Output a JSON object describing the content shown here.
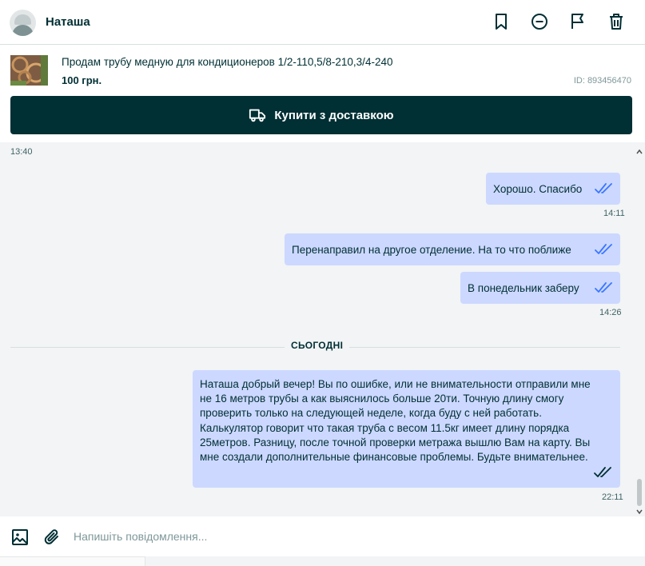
{
  "header": {
    "user_name": "Наташа",
    "icons": [
      "bookmark-icon",
      "block-icon",
      "flag-icon",
      "trash-icon"
    ]
  },
  "ad": {
    "title": "Продам трубу медную для кондиционеров 1/2-110,5/8-210,3/4-240",
    "price": "100 грн.",
    "id_label": "ID: 893456470"
  },
  "buy_button": {
    "label": "Купити з доставкою",
    "icon": "truck-icon"
  },
  "chat": {
    "top_timestamp": "13:40",
    "messages": [
      {
        "text": "Хорошо. Спасибо",
        "time": "14:11"
      },
      {
        "text": "Перенаправил на другое отделение. На то что поближе",
        "time": ""
      },
      {
        "text": "В понедельник заберу",
        "time": "14:26"
      }
    ],
    "day_separator": "СЬОГОДНІ",
    "last_message": {
      "lines": [
        "Наташа добрый вечер! Вы по ошибке, или не внимательности отправили мне",
        "не 16 метров трубы а как выяснилось больше 20ти. Точную длину смогу",
        "проверить только на следующей неделе, когда буду с ней работать.",
        "Калькулятор говорит что такая труба с весом 11.5кг имеет длину порядка",
        "25метров. Разницу, после точной проверки метража вышлю Вам на карту. Вы",
        "мне создали дополнительные финансовые проблемы. Будьте внимательнее."
      ],
      "time": "22:11"
    }
  },
  "composer": {
    "placeholder": "Напишіть повідомлення...",
    "icons": [
      "image-icon",
      "paperclip-icon"
    ]
  },
  "colors": {
    "primary": "#002f34",
    "bubble": "#ccd8ff",
    "chat_bg": "#f2f4f5",
    "tick_blue": "#3a77ff"
  }
}
